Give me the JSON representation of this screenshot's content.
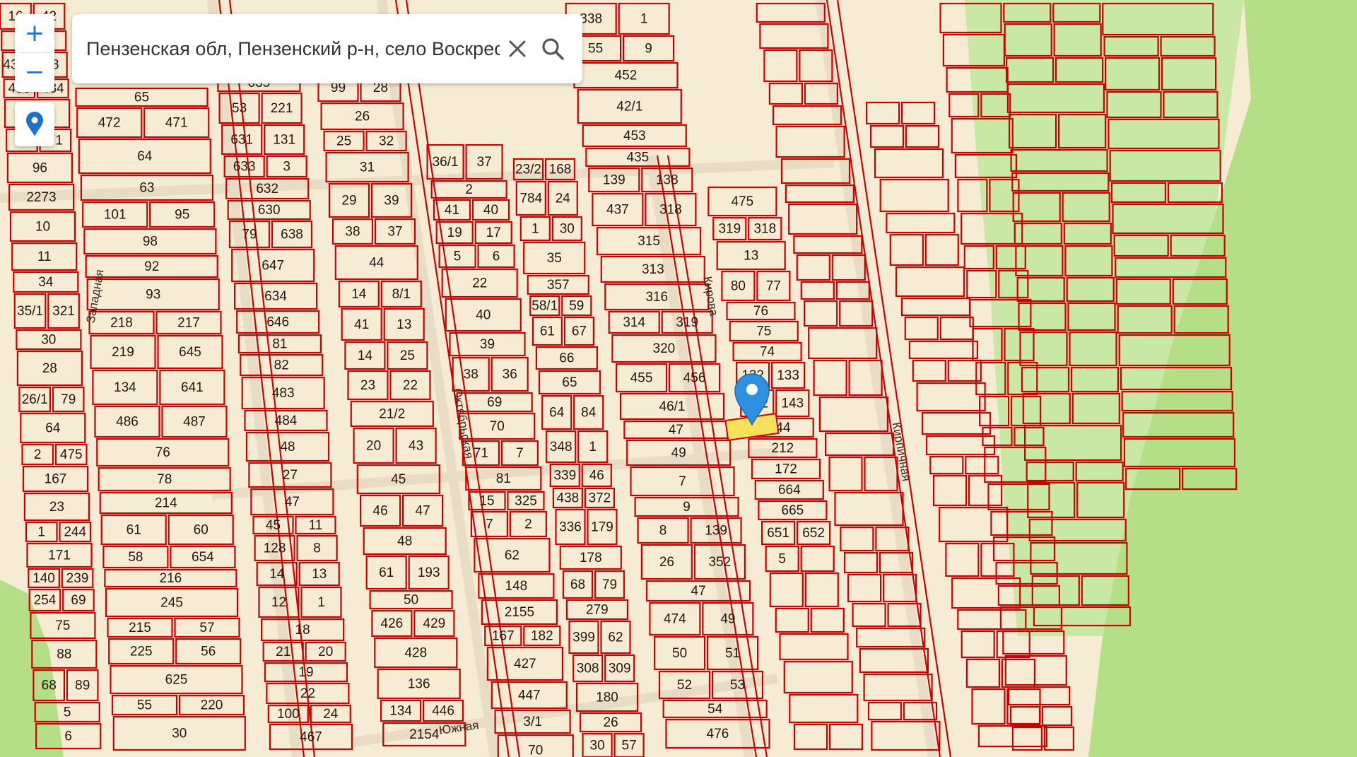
{
  "search": {
    "value": "Пензенская обл, Пензенский р-н, село Воскресеновка",
    "clear_icon": "close-icon",
    "search_icon": "search-icon"
  },
  "controls": {
    "zoom_in_label": "+",
    "zoom_out_label": "−",
    "location_icon": "map-pin-icon"
  },
  "streets": [
    {
      "name": "Западная"
    },
    {
      "name": "Октябрьская"
    },
    {
      "name": "Кирова"
    },
    {
      "name": "Кирпичная"
    },
    {
      "name": "Южная"
    }
  ],
  "plots": [
    "16",
    "42",
    "485",
    "4376",
    "33",
    "433",
    "434",
    "57",
    "70",
    "71",
    "96",
    "2273",
    "10",
    "11",
    "34",
    "35/1",
    "321",
    "30",
    "28",
    "26/1",
    "79",
    "64",
    "2",
    "475",
    "167",
    "23",
    "1",
    "244",
    "171",
    "140",
    "239",
    "254",
    "69",
    "75",
    "88",
    "68",
    "89",
    "5",
    "6",
    "65",
    "472",
    "471",
    "64",
    "63",
    "101",
    "95",
    "98",
    "92",
    "93",
    "218",
    "217",
    "219",
    "645",
    "134",
    "641",
    "486",
    "487",
    "76",
    "78",
    "214",
    "61",
    "60",
    "58",
    "654",
    "216",
    "245",
    "215",
    "57",
    "225",
    "56",
    "625",
    "55",
    "220",
    "30",
    "635",
    "53",
    "221",
    "631",
    "131",
    "633",
    "3",
    "632",
    "630",
    "79",
    "638",
    "647",
    "634",
    "646",
    "81",
    "82",
    "483",
    "484",
    "48",
    "27",
    "47",
    "45",
    "11",
    "128",
    "8",
    "14",
    "13",
    "12",
    "1",
    "18",
    "21",
    "20",
    "19",
    "22",
    "100",
    "24",
    "467",
    "99",
    "28",
    "26",
    "25",
    "32",
    "31",
    "29",
    "39",
    "38",
    "37",
    "44",
    "14",
    "8/1",
    "41",
    "13",
    "14",
    "25",
    "23",
    "22",
    "21/2",
    "20",
    "43",
    "45",
    "46",
    "47",
    "48",
    "61",
    "193",
    "50",
    "426",
    "429",
    "428",
    "136",
    "134",
    "446",
    "2154",
    "36/1",
    "37",
    "2",
    "41",
    "40",
    "19",
    "17",
    "5",
    "6",
    "22",
    "40",
    "39",
    "38",
    "36",
    "69",
    "70",
    "71",
    "7",
    "81",
    "15",
    "325",
    "7",
    "2",
    "62",
    "148",
    "2155",
    "167",
    "182",
    "427",
    "447",
    "3/1",
    "70",
    "23/2",
    "168",
    "784",
    "24",
    "1",
    "30",
    "35",
    "357",
    "58/1",
    "59",
    "61",
    "67",
    "66",
    "65",
    "64",
    "84",
    "348",
    "1",
    "339",
    "46",
    "438",
    "372",
    "336",
    "179",
    "178",
    "68",
    "79",
    "279",
    "399",
    "62",
    "308",
    "309",
    "180",
    "26",
    "30",
    "57",
    "338",
    "1",
    "55",
    "9",
    "452",
    "42/1",
    "453",
    "435",
    "139",
    "138",
    "437",
    "318",
    "315",
    "313",
    "316",
    "314",
    "319",
    "320",
    "455",
    "456",
    "46/1",
    "47",
    "49",
    "7",
    "9",
    "8",
    "139",
    "26",
    "352",
    "47",
    "474",
    "49",
    "50",
    "51",
    "52",
    "53",
    "54",
    "476",
    "475",
    "319",
    "318",
    "13",
    "80",
    "77",
    "76",
    "75",
    "74",
    "132",
    "133",
    "142",
    "143",
    "144",
    "212",
    "172",
    "664",
    "665",
    "651",
    "652",
    "5"
  ],
  "marker": {
    "icon": "map-marker-icon",
    "color": "#2f8fe0"
  },
  "colors": {
    "background": "#f6ecd4",
    "boundary": "#cc0000",
    "green_zone": "#b5df86"
  }
}
